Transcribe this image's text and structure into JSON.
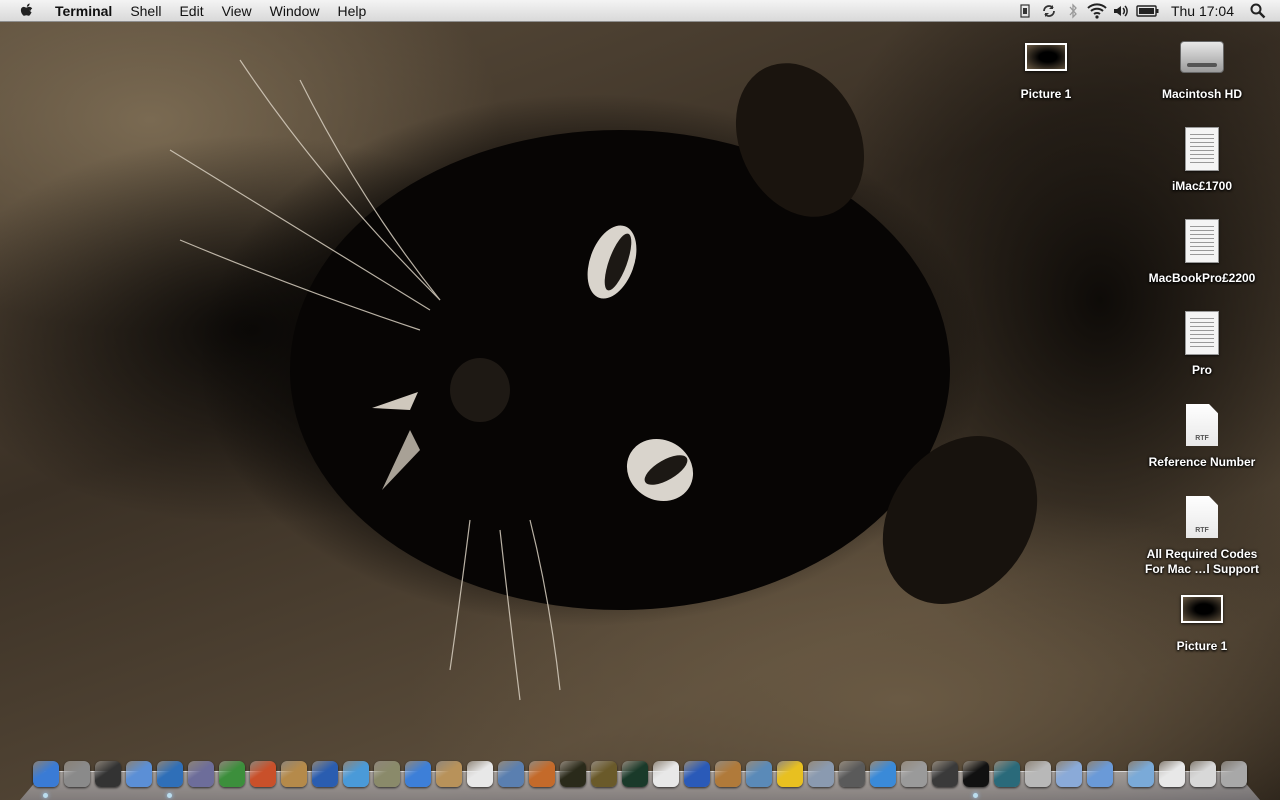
{
  "menubar": {
    "apple_menu": "apple-icon",
    "app_name": "Terminal",
    "menus": [
      "Shell",
      "Edit",
      "View",
      "Window",
      "Help"
    ],
    "status_icons": [
      "battery-status-icon",
      "sync-icon",
      "bluetooth-icon",
      "wifi-icon",
      "volume-icon",
      "battery-icon"
    ],
    "clock": "Thu 17:04",
    "spotlight": "spotlight-icon"
  },
  "desktop": {
    "icons": [
      {
        "label": "Picture 1",
        "kind": "image"
      },
      {
        "label": "Macintosh HD",
        "kind": "disk"
      },
      {
        "label": "iMac£1700",
        "kind": "document"
      },
      {
        "label": "MacBookPro£2200",
        "kind": "document"
      },
      {
        "label": "Pro",
        "kind": "document"
      },
      {
        "label": "Reference Number",
        "kind": "rtf",
        "badge": "RTF"
      },
      {
        "label": "All Required Codes\nFor Mac …l Support",
        "kind": "rtf",
        "badge": "RTF"
      },
      {
        "label": "Picture 1",
        "kind": "image"
      }
    ]
  },
  "dock": {
    "apps": [
      {
        "name": "finder-icon",
        "color": "#3a7bd5",
        "running": true
      },
      {
        "name": "system-preferences-icon",
        "color": "#8a8a8a",
        "running": false
      },
      {
        "name": "dashboard-icon",
        "color": "#333333",
        "running": false
      },
      {
        "name": "preview-icon",
        "color": "#5b8fd6",
        "running": false
      },
      {
        "name": "network-utility-icon",
        "color": "#2f6fb8",
        "running": true
      },
      {
        "name": "script-editor-icon",
        "color": "#6d6d9a",
        "running": false
      },
      {
        "name": "grapher-icon",
        "color": "#3c8f3c",
        "running": false
      },
      {
        "name": "photo-booth-icon",
        "color": "#c9502a",
        "running": false
      },
      {
        "name": "image-capture-icon",
        "color": "#b58a4a",
        "running": false
      },
      {
        "name": "dvd-player-icon",
        "color": "#2a5db0",
        "running": false
      },
      {
        "name": "itunes-icon",
        "color": "#4a9ad8",
        "running": false
      },
      {
        "name": "imovie-icon",
        "color": "#8a8a6a",
        "running": false
      },
      {
        "name": "ichat-icon",
        "color": "#3d7fd8",
        "running": false
      },
      {
        "name": "address-book-icon",
        "color": "#b8925a",
        "running": false
      },
      {
        "name": "ical-icon",
        "color": "#e8e8e8",
        "running": false
      },
      {
        "name": "iphoto-icon",
        "color": "#5a7fb0",
        "running": false
      },
      {
        "name": "aperture-icon",
        "color": "#c46a2a",
        "running": false
      },
      {
        "name": "console-icon",
        "color": "#2a2a1a",
        "running": false
      },
      {
        "name": "disk-utility-icon",
        "color": "#6a5a2a",
        "running": false
      },
      {
        "name": "activity-monitor-icon",
        "color": "#1a3a2a",
        "running": false
      },
      {
        "name": "textedit-icon",
        "color": "#e8e8e8",
        "running": false
      },
      {
        "name": "bluetooth-utility-icon",
        "color": "#2a5ab8",
        "running": false
      },
      {
        "name": "garageband-icon",
        "color": "#b07a3a",
        "running": false
      },
      {
        "name": "automator-icon",
        "color": "#5a8ab8",
        "running": false
      },
      {
        "name": "console-warning-icon",
        "color": "#e8c020",
        "running": false
      },
      {
        "name": "migration-assistant-icon",
        "color": "#8a9ab0",
        "running": false
      },
      {
        "name": "boot-camp-icon",
        "color": "#5a5a5a",
        "running": false
      },
      {
        "name": "safari-icon",
        "color": "#3a8ad8",
        "running": false
      },
      {
        "name": "system-profiler-icon",
        "color": "#9a9a9a",
        "running": false
      },
      {
        "name": "instruments-icon",
        "color": "#3a3a3a",
        "running": false
      },
      {
        "name": "terminal-icon",
        "color": "#111111",
        "running": true
      },
      {
        "name": "time-machine-icon",
        "color": "#2a6a7a",
        "running": false
      },
      {
        "name": "printer-icon",
        "color": "#b8b8b8",
        "running": false
      },
      {
        "name": "photo-icon",
        "color": "#8aaad8",
        "running": false
      },
      {
        "name": "network-icon",
        "color": "#6a9ad8",
        "running": false
      }
    ],
    "stacks": [
      {
        "name": "applications-folder-icon",
        "color": "#7aaad8"
      },
      {
        "name": "documents-stack-icon",
        "color": "#e8e8e8"
      },
      {
        "name": "downloads-stack-icon",
        "color": "#d8d8d8"
      },
      {
        "name": "trash-icon",
        "color": "#a8a8a8"
      }
    ]
  }
}
